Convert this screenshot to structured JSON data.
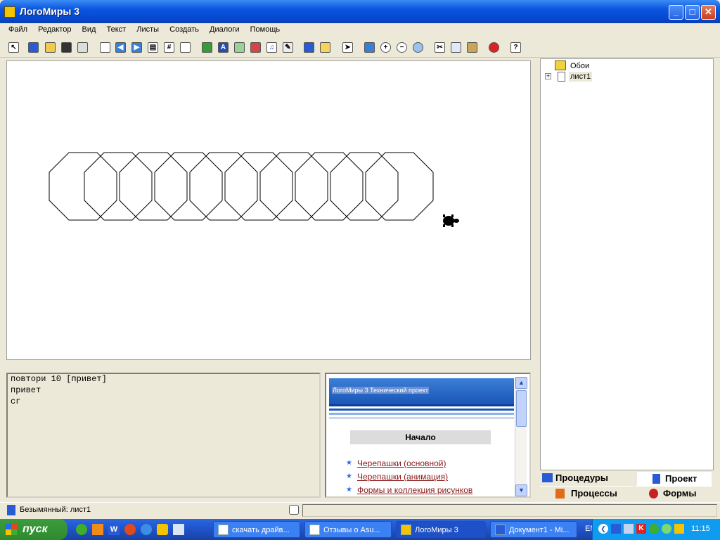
{
  "window": {
    "title": "ЛогоМиры 3",
    "minimize": "_",
    "maximize": "□",
    "close": "✕"
  },
  "menu": [
    "Файл",
    "Редактор",
    "Вид",
    "Текст",
    "Листы",
    "Создать",
    "Диалоги",
    "Помощь"
  ],
  "toolbar": {
    "items": [
      "pointer-icon",
      "logo-icon",
      "open-folder-icon",
      "save-icon",
      "print-icon",
      "new-page-icon",
      "back-arrow-icon",
      "forward-arrow-icon",
      "page-view-icon",
      "grid-icon",
      "frame-icon",
      "turtle-icon",
      "text-box-icon",
      "button-icon",
      "slider-icon",
      "music-note-icon",
      "paint-icon",
      "clipboard-icon",
      "pencil-icon",
      "arrow-cursor-icon",
      "stamp-icon",
      "zoom-in-icon",
      "zoom-out-icon",
      "eye-icon",
      "scissors-icon",
      "copy-icon",
      "paste-icon",
      "stop-icon",
      "help-icon"
    ],
    "help_label": "?"
  },
  "commands": [
    "повтори 10 [привет]",
    "привет",
    "сг"
  ],
  "help": {
    "banner": "ЛогоМиры 3 Технический проект",
    "start": "Начало",
    "links": [
      "Черепашки (основной)",
      "Черепашки (анимация)",
      "Формы и коллекция рисунков"
    ]
  },
  "tree": {
    "items": [
      "Обои",
      "лист1"
    ],
    "expander": "+"
  },
  "tabs": {
    "procedures": "Процедуры",
    "project": "Проект",
    "processes": "Процессы",
    "shapes": "Формы"
  },
  "status": {
    "text": "Безымянный:  лист1"
  },
  "taskbar": {
    "start": "пуск",
    "tasks": [
      "скачать драйв...",
      "Отзывы о Asu...",
      "ЛогоМиры 3",
      "Документ1 - Mi..."
    ],
    "lang": "EN",
    "clock": "11:15"
  }
}
